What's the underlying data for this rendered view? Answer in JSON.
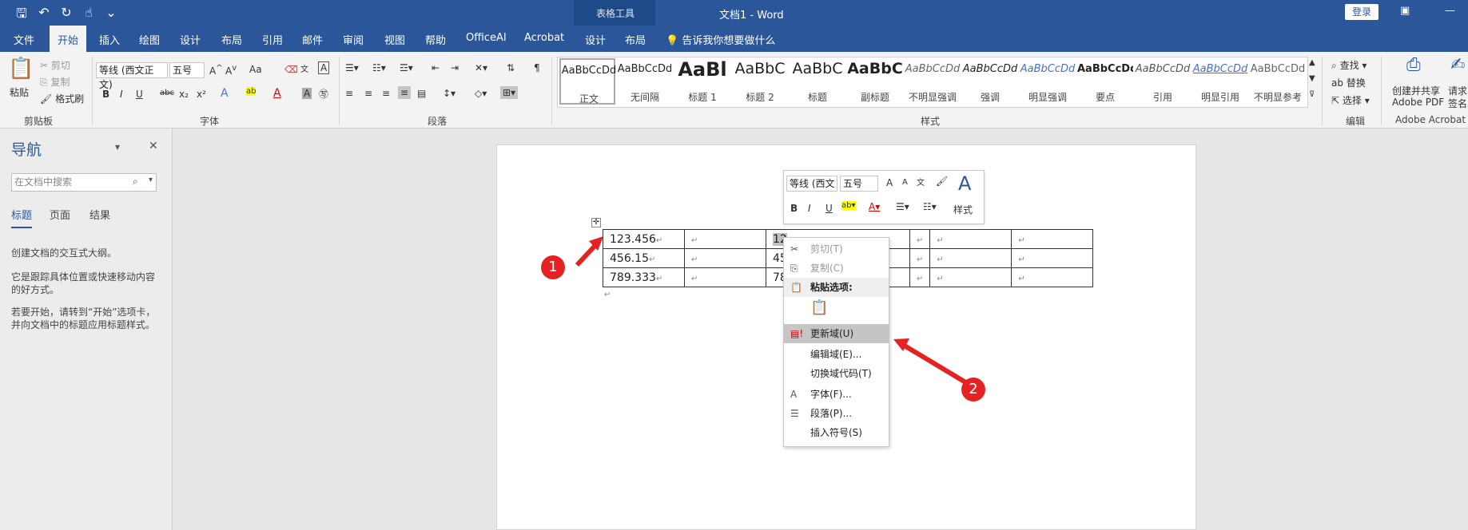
{
  "titlebar": {
    "table_tools": "表格工具",
    "title": "文档1  -  Word",
    "login": "登录"
  },
  "tabs": [
    "文件",
    "开始",
    "插入",
    "绘图",
    "设计",
    "布局",
    "引用",
    "邮件",
    "审阅",
    "视图",
    "帮助",
    "OfficeAI",
    "Acrobat",
    "设计",
    "布局"
  ],
  "tellme": "告诉我你想要做什么",
  "ribbon": {
    "clipboard": {
      "paste": "粘贴",
      "cut": "剪切",
      "copy": "复制",
      "format_painter": "格式刷",
      "label": "剪贴板"
    },
    "font": {
      "name": "等线 (西文正文)",
      "size": "五号",
      "aa": "Aa",
      "label": "字体"
    },
    "paragraph": {
      "label": "段落"
    },
    "styles": {
      "label": "样式",
      "items": [
        {
          "sample": "AaBbCcDd",
          "name": "正文"
        },
        {
          "sample": "AaBbCcDd",
          "name": "无间隔"
        },
        {
          "sample": "AaBl",
          "name": "标题 1"
        },
        {
          "sample": "AaBbC",
          "name": "标题 2"
        },
        {
          "sample": "AaBbC",
          "name": "标题"
        },
        {
          "sample": "AaBbC",
          "name": "副标题"
        },
        {
          "sample": "AaBbCcDd",
          "name": "不明显强调"
        },
        {
          "sample": "AaBbCcDd",
          "name": "强调"
        },
        {
          "sample": "AaBbCcDd",
          "name": "明显强调"
        },
        {
          "sample": "AaBbCcDd",
          "name": "要点"
        },
        {
          "sample": "AaBbCcDd",
          "name": "引用"
        },
        {
          "sample": "AaBbCcDd",
          "name": "明显引用"
        },
        {
          "sample": "AaBbCcDd",
          "name": "不明显参考"
        }
      ]
    },
    "editing": {
      "find": "查找",
      "replace": "替换",
      "select": "选择",
      "label": "编辑"
    },
    "acrobat": {
      "create": "创建并共享",
      "create2": "Adobe PDF",
      "request": "请求",
      "request2": "签名",
      "label": "Adobe Acrobat"
    }
  },
  "nav": {
    "title": "导航",
    "search_placeholder": "在文档中搜索",
    "tabs": [
      "标题",
      "页面",
      "结果"
    ],
    "text1": "创建文档的交互式大纲。",
    "text2": "它是跟踪具体位置或快速移动内容的好方式。",
    "text3": "若要开始，请转到“开始”选项卡，并向文档中的标题应用标题样式。"
  },
  "table": {
    "rows": [
      [
        "123.456",
        "12"
      ],
      [
        "456.15",
        "45"
      ],
      [
        "789.333",
        "78"
      ]
    ]
  },
  "mini_toolbar": {
    "font": "等线 (西文",
    "size": "五号",
    "styles": "样式"
  },
  "context_menu": {
    "cut": "剪切(T)",
    "copy": "复制(C)",
    "paste_options": "粘贴选项:",
    "update_field": "更新域(U)",
    "edit_field": "编辑域(E)...",
    "toggle_codes": "切换域代码(T)",
    "font": "字体(F)...",
    "paragraph": "段落(P)...",
    "insert_symbol": "插入符号(S)"
  },
  "callouts": [
    "1",
    "2"
  ],
  "colors": {
    "accent": "#2b579a",
    "callout": "#e52222"
  }
}
